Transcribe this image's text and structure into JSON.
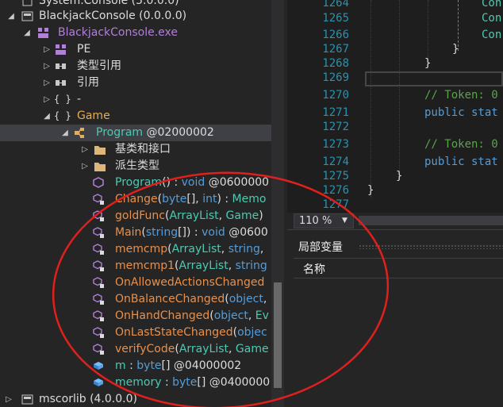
{
  "tree": {
    "rows": [
      {
        "text": "System.Console (5.0.0.0)",
        "cls": "txt-w"
      },
      {
        "text": "BlackjackConsole (0.0.0.0)",
        "cls": "txt-w"
      },
      {
        "text": "BlackjackConsole.exe",
        "cls": "txt-p"
      },
      {
        "text": "PE",
        "cls": "txt-w"
      },
      {
        "text": "类型引用",
        "cls": "txt-w"
      },
      {
        "text": "引用",
        "cls": "txt-w"
      },
      {
        "text": "-",
        "cls": "txt-w"
      },
      {
        "text": "Game",
        "cls": "txt-y"
      },
      {
        "text_a": "Program",
        "text_b": " @02000002"
      },
      {
        "text": "基类和接口",
        "cls": "txt-w"
      },
      {
        "text": "派生类型",
        "cls": "txt-w"
      },
      {
        "name": "Program",
        "args": "()",
        "sep": " : ",
        "ret": "void",
        "tail": " @0600000"
      },
      {
        "name": "Change",
        "args_a": "(",
        "a1": "byte",
        "a2": "[], ",
        "a3": "int",
        "a4": ") : ",
        "ret": "Memo"
      },
      {
        "name": "goldFunc",
        "args_a": "(",
        "a1": "ArrayList",
        "a2": ", ",
        "a3": "Game",
        "a4": ")"
      },
      {
        "name": "Main",
        "args_a": "(",
        "a1": "string",
        "a2": "[]) : ",
        "a3": "void",
        "a4": " @0600"
      },
      {
        "name": "memcmp",
        "args_a": "(",
        "a1": "ArrayList",
        "a2": ", ",
        "a3": "string",
        "a4": ","
      },
      {
        "name": "memcmp1",
        "args_a": "(",
        "a1": "ArrayList",
        "a2": ", ",
        "a3": "string",
        "a4": ""
      },
      {
        "name": "OnAllowedActionsChanged",
        "args_a": "",
        "a1": "",
        "a2": "",
        "a3": "",
        "a4": ""
      },
      {
        "name": "OnBalanceChanged",
        "args_a": "(",
        "a1": "object",
        "a2": ", ",
        "a3": "Ev",
        "a4": ""
      },
      {
        "name": "OnHandChanged",
        "args_a": "(",
        "a1": "object",
        "a2": ", ",
        "a3": "Ev",
        "a4": ""
      },
      {
        "name": "OnLastStateChanged",
        "args_a": "(",
        "a1": "objec",
        "a2": "",
        "a3": "",
        "a4": ""
      },
      {
        "name": "verifyCode",
        "args_a": "(",
        "a1": "ArrayList",
        "a2": ", ",
        "a3": "Game",
        "a4": ""
      },
      {
        "name": "m",
        "sep": " : ",
        "ret": "byte",
        "tail": "[] @04000002"
      },
      {
        "name": "memory",
        "sep": " : ",
        "ret": "byte",
        "tail": "[] @0400000"
      },
      {
        "text": "mscorlib (4.0.0.0)",
        "cls": "txt-w"
      }
    ]
  },
  "editor": {
    "line_numbers": [
      "1264",
      "1265",
      "1266",
      "1267",
      "1268",
      "1269",
      "1270",
      "1271",
      "1272",
      "1273",
      "1274",
      "1275",
      "1276",
      "1277"
    ],
    "code": {
      "l1264": "Con",
      "l1265": "Con",
      "l1266": "Con",
      "l1267": "}",
      "l1268": "}",
      "l1270": "// Token: 0",
      "l1271_kw": "public stat",
      "l1273": "// Token: 0",
      "l1274_kw": "public stat",
      "l1275": "}",
      "l1276": "}"
    }
  },
  "zoom": {
    "value": "110 %",
    "dropdown": "▼"
  },
  "locals": {
    "title": "局部变量",
    "column_name": "名称"
  },
  "colors": {
    "annotation": "#e0201c"
  }
}
